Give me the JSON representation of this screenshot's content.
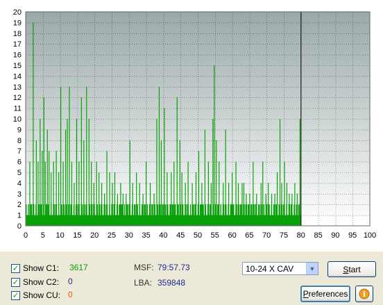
{
  "chart_data": {
    "type": "bar",
    "x_ticks": [
      0,
      5,
      10,
      15,
      20,
      25,
      30,
      35,
      40,
      45,
      50,
      55,
      60,
      65,
      70,
      75,
      80,
      85,
      90,
      95,
      100
    ],
    "y_ticks": [
      0,
      1,
      2,
      3,
      4,
      5,
      6,
      7,
      8,
      9,
      10,
      11,
      12,
      13,
      14,
      15,
      16,
      17,
      18,
      19,
      20
    ],
    "xlim": [
      0,
      100
    ],
    "ylim": [
      0,
      20
    ],
    "data_end_x": 80,
    "baseline_value": 2,
    "grid": true,
    "series": [
      {
        "color": "#0aa00a",
        "spikes": [
          [
            1.2,
            6
          ],
          [
            2.2,
            19
          ],
          [
            3.1,
            8
          ],
          [
            3.6,
            6
          ],
          [
            4.2,
            10
          ],
          [
            4.8,
            7
          ],
          [
            5.3,
            12
          ],
          [
            5.7,
            6
          ],
          [
            6.3,
            9
          ],
          [
            6.8,
            7
          ],
          [
            7.4,
            5
          ],
          [
            8.1,
            6
          ],
          [
            8.9,
            7
          ],
          [
            9.6,
            5
          ],
          [
            10.2,
            13
          ],
          [
            10.9,
            6
          ],
          [
            11.6,
            9
          ],
          [
            12.1,
            10
          ],
          [
            12.7,
            13
          ],
          [
            13.4,
            6
          ],
          [
            14.1,
            4
          ],
          [
            14.8,
            10
          ],
          [
            15.5,
            6
          ],
          [
            16.2,
            12
          ],
          [
            16.9,
            8
          ],
          [
            17.7,
            13
          ],
          [
            18.4,
            10
          ],
          [
            19.1,
            6
          ],
          [
            19.8,
            4
          ],
          [
            20.6,
            6
          ],
          [
            21.3,
            5
          ],
          [
            22.1,
            4
          ],
          [
            22.9,
            3
          ],
          [
            23.6,
            7
          ],
          [
            24.4,
            5
          ],
          [
            25.2,
            4
          ],
          [
            25.9,
            5
          ],
          [
            26.7,
            3
          ],
          [
            27.6,
            4
          ],
          [
            28.3,
            3
          ],
          [
            29.2,
            3
          ],
          [
            30.3,
            8
          ],
          [
            31.1,
            4
          ],
          [
            32.2,
            5
          ],
          [
            33.1,
            4
          ],
          [
            34.1,
            3
          ],
          [
            35.0,
            6
          ],
          [
            36.2,
            4
          ],
          [
            37.3,
            3
          ],
          [
            38.1,
            10
          ],
          [
            38.8,
            13
          ],
          [
            39.4,
            8
          ],
          [
            40.3,
            11
          ],
          [
            41.1,
            5
          ],
          [
            42.3,
            5
          ],
          [
            43.1,
            6
          ],
          [
            44.0,
            12
          ],
          [
            44.8,
            8
          ],
          [
            45.4,
            5
          ],
          [
            46.4,
            4
          ],
          [
            47.2,
            6
          ],
          [
            48.4,
            4
          ],
          [
            49.5,
            5
          ],
          [
            50.3,
            7
          ],
          [
            51.2,
            4
          ],
          [
            52.1,
            9
          ],
          [
            53.1,
            6
          ],
          [
            53.9,
            4
          ],
          [
            54.4,
            10
          ],
          [
            54.8,
            15
          ],
          [
            55.4,
            8
          ],
          [
            56.2,
            6
          ],
          [
            57.4,
            4
          ],
          [
            58.1,
            9
          ],
          [
            59.0,
            4
          ],
          [
            60.0,
            5
          ],
          [
            61.1,
            6
          ],
          [
            61.8,
            4
          ],
          [
            62.9,
            4
          ],
          [
            63.4,
            4
          ],
          [
            64.1,
            3
          ],
          [
            65.1,
            3
          ],
          [
            66.1,
            6
          ],
          [
            67.1,
            3
          ],
          [
            68.4,
            4
          ],
          [
            68.9,
            6
          ],
          [
            69.8,
            3
          ],
          [
            70.5,
            4
          ],
          [
            71.5,
            3
          ],
          [
            72.4,
            3
          ],
          [
            73.1,
            5
          ],
          [
            73.9,
            10
          ],
          [
            74.4,
            4
          ],
          [
            75.2,
            6
          ],
          [
            75.9,
            4
          ],
          [
            76.6,
            3
          ],
          [
            77.4,
            3
          ],
          [
            78.2,
            4
          ],
          [
            78.9,
            3
          ],
          [
            79.7,
            10
          ]
        ]
      }
    ]
  },
  "controls": {
    "c1": {
      "label": "Show C1:",
      "checked_glyph": "✓",
      "value": "3617",
      "color": "#0aa00a"
    },
    "c2": {
      "label": "Show C2:",
      "checked_glyph": "✓",
      "value": "0",
      "color": "#1f2a8c"
    },
    "cu": {
      "label": "Show CU:",
      "checked_glyph": "✓",
      "value": "0",
      "color": "#e05a10"
    }
  },
  "info": {
    "msf_label": "MSF:",
    "msf_value": "79:57.73",
    "lba_label": "LBA:",
    "lba_value": "359848"
  },
  "speed_select": {
    "value": "10-24 X CAV"
  },
  "buttons": {
    "start_rest": "tart",
    "start_key": "S",
    "prefs_key": "P",
    "prefs_rest": "references",
    "info_icon": "i"
  }
}
